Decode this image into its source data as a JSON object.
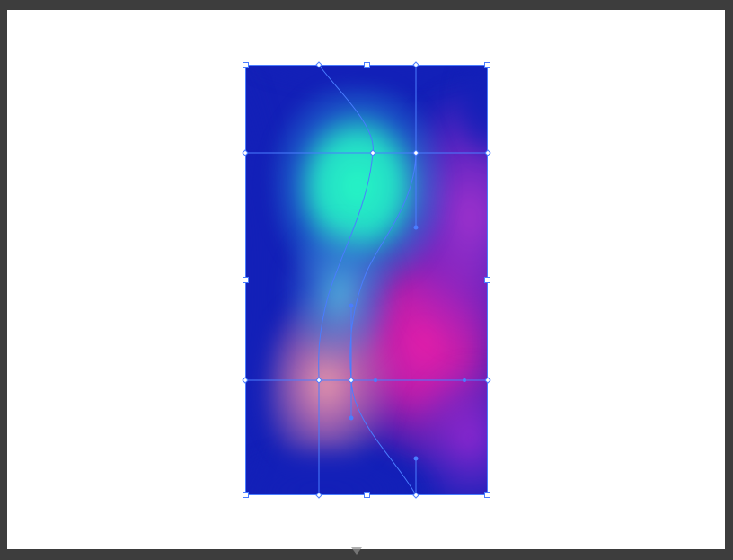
{
  "app": {
    "workspace_color": "#3d3d3d",
    "artboard_color": "#ffffff"
  },
  "object": {
    "type": "gradient-mesh",
    "colors": {
      "base": "#1320b8",
      "teal": "#23f4c4",
      "magenta": "#e21fa9",
      "purple": "#9a2bd0",
      "peach": "#f29aa6",
      "selection": "#4a7dff"
    }
  },
  "icons": {
    "anchor_point": "square-anchor-icon",
    "mesh_point": "diamond-mesh-point-icon",
    "handle": "round-handle-icon",
    "scroll": "chevron-down-icon"
  }
}
